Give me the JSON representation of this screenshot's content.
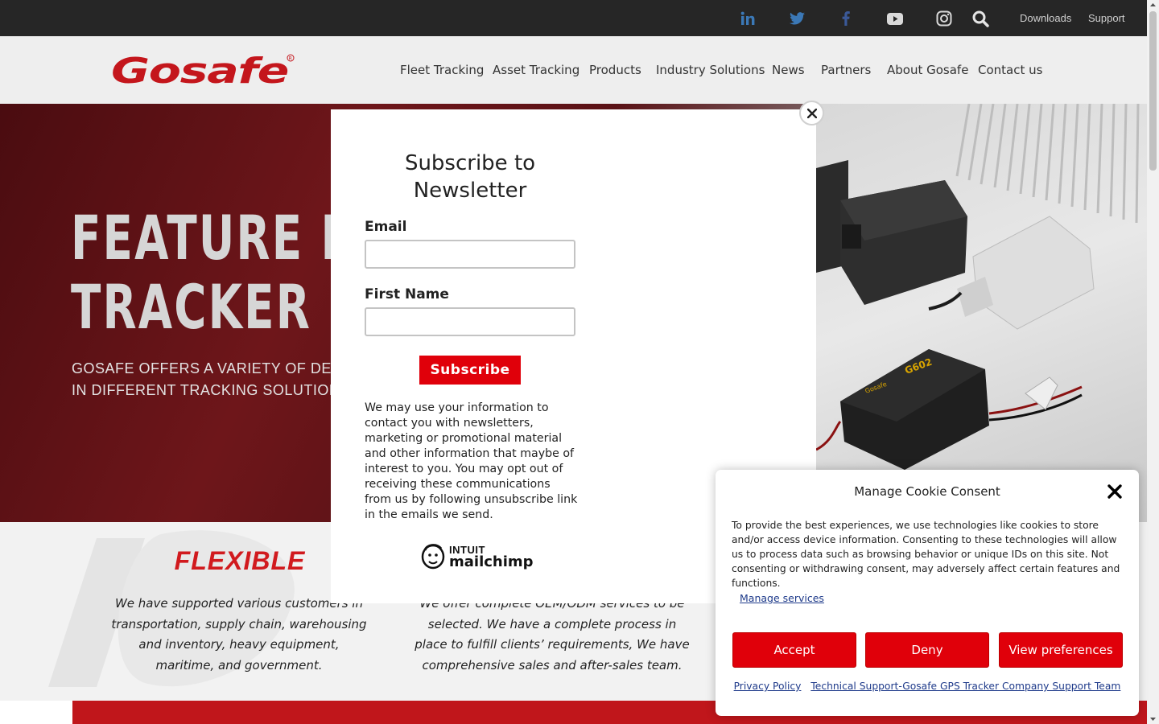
{
  "topbar": {
    "social_icons": [
      "linkedin-icon",
      "twitter-icon",
      "facebook-icon",
      "youtube-icon",
      "instagram-icon"
    ],
    "search_icon": "search-icon",
    "downloads": "Downloads",
    "support": "Support"
  },
  "header": {
    "logo_text": "Gosafe",
    "nav": [
      "Fleet Tracking",
      "Asset Tracking",
      "Products",
      "Industry Solutions",
      "News",
      "Partners",
      "About Gosafe",
      "Contact us"
    ]
  },
  "hero": {
    "title_line1": "FEATURE RI",
    "title_line2": "TRACKER",
    "sub_line1": "GOSAFE OFFERS A VARIETY OF DEVI",
    "sub_line2": "IN DIFFERENT TRACKING SOLUTION",
    "device_label": "G602",
    "device_brand": "Gosafe"
  },
  "features": {
    "flexible_title": "FLEXIBLE",
    "flexible_text": "We have supported various customers in transportation, supply chain, warehousing and inventory, heavy equipment, maritime, and government.",
    "oem_text": "We offer complete OEM/ODM services to be selected. We have a complete process in place to fulfill clients’ requirements, We have comprehensive sales and after-sales team."
  },
  "newsletter": {
    "title": "Subscribe to Newsletter",
    "email_label": "Email",
    "email_value": "",
    "first_name_label": "First Name",
    "first_name_value": "",
    "subscribe": "Subscribe",
    "disclaimer": "We may use your information to contact you with newsletters, marketing or promotional material and other information that maybe of interest to you. You may opt out of receiving these communications from us by following unsubscribe link in the emails we send.",
    "mc_line1": "INTUIT",
    "mc_line2": "mailchimp"
  },
  "cookie": {
    "title": "Manage Cookie Consent",
    "text": "To provide the best experiences, we use technologies like cookies to store and/or access device information. Consenting to these technologies will allow us to process data such as browsing behavior or unique IDs on this site. Not consenting or withdrawing consent, may adversely affect certain features and functions.",
    "manage": "Manage services",
    "accept": "Accept",
    "deny": "Deny",
    "preferences": "View preferences",
    "privacy": "Privacy Policy",
    "support_link": "Technical Support-Gosafe GPS Tracker Company Support Team"
  },
  "colors": {
    "brand_red": "#e0000a",
    "topbar": "#262626",
    "header": "#eeeeee"
  }
}
